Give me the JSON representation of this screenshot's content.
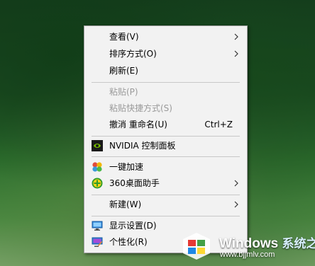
{
  "context_menu": {
    "items": [
      {
        "label": "查看(V)",
        "has_submenu": true
      },
      {
        "label": "排序方式(O)",
        "has_submenu": true
      },
      {
        "label": "刷新(E)"
      },
      {
        "label": "粘贴(P)",
        "disabled": true
      },
      {
        "label": "粘贴快捷方式(S)",
        "disabled": true
      },
      {
        "label": "撤消 重命名(U)",
        "shortcut": "Ctrl+Z"
      },
      {
        "label": "NVIDIA 控制面板",
        "icon": "nvidia-icon"
      },
      {
        "label": "一键加速",
        "icon": "speedup-icon"
      },
      {
        "label": "360桌面助手",
        "icon": "360-desktop-icon",
        "has_submenu": true
      },
      {
        "label": "新建(W)",
        "has_submenu": true
      },
      {
        "label": "显示设置(D)",
        "icon": "display-settings-icon"
      },
      {
        "label": "个性化(R)",
        "icon": "personalize-icon"
      }
    ]
  },
  "watermark": {
    "brand": "Windows",
    "brand_cn": "系统之家",
    "url": "www.bjjmlv.com"
  },
  "colors": {
    "menu_bg": "#f2f2f2",
    "menu_border": "#a0a0a0",
    "disabled_text": "#9a9a9a"
  }
}
